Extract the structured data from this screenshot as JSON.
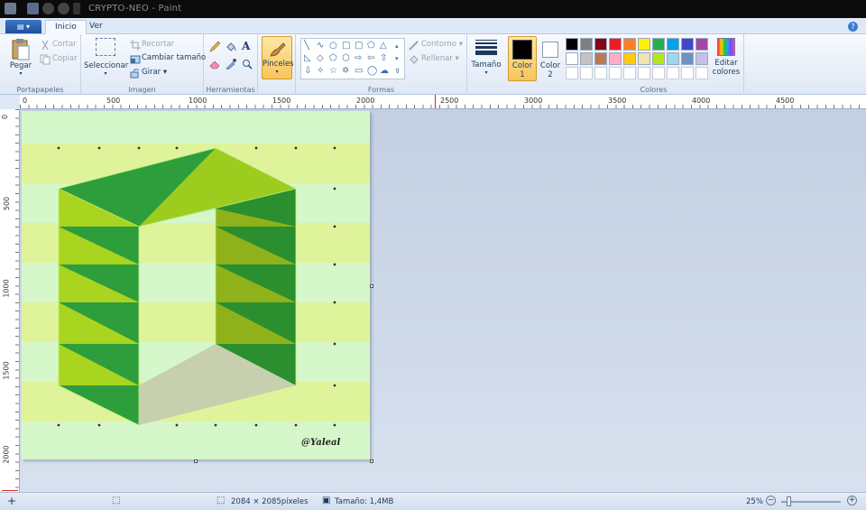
{
  "window": {
    "title": "CRYPTO-NEO - Paint"
  },
  "tabs": [
    {
      "label": "Inicio"
    },
    {
      "label": "Ver"
    }
  ],
  "clipboard": {
    "paste": "Pegar",
    "cut": "Cortar",
    "copy": "Copiar",
    "label": "Portapapeles"
  },
  "image": {
    "select": "Seleccionar",
    "crop": "Recortar",
    "resize": "Cambiar tamaño",
    "rotate": "Girar",
    "label": "Imagen"
  },
  "tools": {
    "label": "Herramientas"
  },
  "brushes": {
    "label": "Pinceles"
  },
  "shapes": {
    "outline": "Contorno",
    "fill": "Rellenar",
    "label": "Formas"
  },
  "size": {
    "label": "Tamaño"
  },
  "color1": {
    "label": "Color",
    "num": "1"
  },
  "color2": {
    "label": "Color",
    "num": "2"
  },
  "edit_colors": {
    "line1": "Editar",
    "line2": "colores"
  },
  "colors": {
    "label": "Colores",
    "row1": [
      "#000000",
      "#7f7f7f",
      "#880015",
      "#ed1c24",
      "#ff7f27",
      "#fff200",
      "#22b14c",
      "#00a2e8",
      "#3f48cc",
      "#a349a4"
    ],
    "row2": [
      "#ffffff",
      "#c3c3c3",
      "#b97a57",
      "#ffaec9",
      "#ffc90e",
      "#efe4b0",
      "#b5e61d",
      "#99d9ea",
      "#7092be",
      "#c8bfe7"
    ]
  },
  "ruler_h": [
    "0",
    "500",
    "1000",
    "1500",
    "2000",
    "2500",
    "3000",
    "3500",
    "4000",
    "4500"
  ],
  "ruler_v": [
    "0",
    "500",
    "1000",
    "1500",
    "2000"
  ],
  "artwork": {
    "signature": "@Yaleal"
  },
  "status": {
    "dimensions": "2084 × 2085píxeles",
    "filesize": "Tamaño: 1,4MB",
    "zoom": "25%"
  }
}
